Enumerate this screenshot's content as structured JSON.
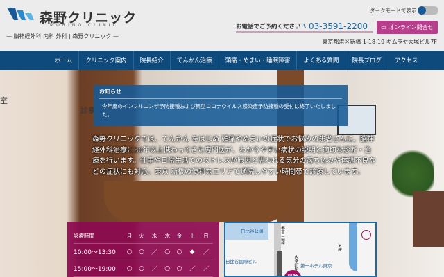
{
  "header": {
    "logo_name": "森野クリニック",
    "logo_en": "MORINO CLINIC",
    "logo_sub": "— 脳神経外科 内科 外科 | 森野クリニック —",
    "dark_mode_label": "ダークモードで表示",
    "tel_label": "お電話でご予約ください",
    "tel_number": "03-3591-2200",
    "online_button": "オンライン問合せ",
    "address": "東京都港区新橋 1-18-19 キムラヤ大塚ビル7F"
  },
  "nav": [
    "ホーム",
    "クリニック案内",
    "院長紹介",
    "てんかん治療",
    "頭痛・めまい・睡眠障害",
    "よくある質問",
    "院長ブログ",
    "アクセス"
  ],
  "hero": {
    "side_text": "室",
    "side_text2": "診察"
  },
  "notice": {
    "title": "お知らせ",
    "body": "今年度のインフルエンザ予防接種および新型コロナウイルス感染症予防接種の受付は終了いたしました。"
  },
  "intro": "森野クリニックでは、てんかん をはじめ 頭痛やめまいの症状でお悩みの患者さんに、脳神経外科治療に30年以上携わってきた専門医が、わかりやすい病状の説明と適切な診断・治療を行います。仕事や日常生活でのストレスが原因と思われる気分の落ち込みや体調不良などの症状にも対応。東京 新橋の便利なエリアで通院しやすい時間帯で診療しています。",
  "hours": {
    "header": [
      "診療時間",
      "月",
      "火",
      "水",
      "木",
      "金",
      "土",
      "日"
    ],
    "rows": [
      [
        "10:00〜13:30",
        "○",
        "○",
        "／",
        "○",
        "○",
        "◆",
        "／"
      ],
      [
        "15:00〜19:00",
        "○",
        "○",
        "／",
        "○",
        "○",
        "／",
        "／"
      ]
    ]
  },
  "map": {
    "labels": {
      "park": "日比谷公園",
      "mita": "都営三田線",
      "building": "日比谷国際ビル",
      "station": "内幸町駅",
      "hotel": "第一ホテル東京",
      "jr": "JR線",
      "clinic": "当院"
    }
  },
  "colors": {
    "nav": "#0e4a7c",
    "accent": "#b63e8c",
    "hours_bg": "#8c0a50"
  }
}
